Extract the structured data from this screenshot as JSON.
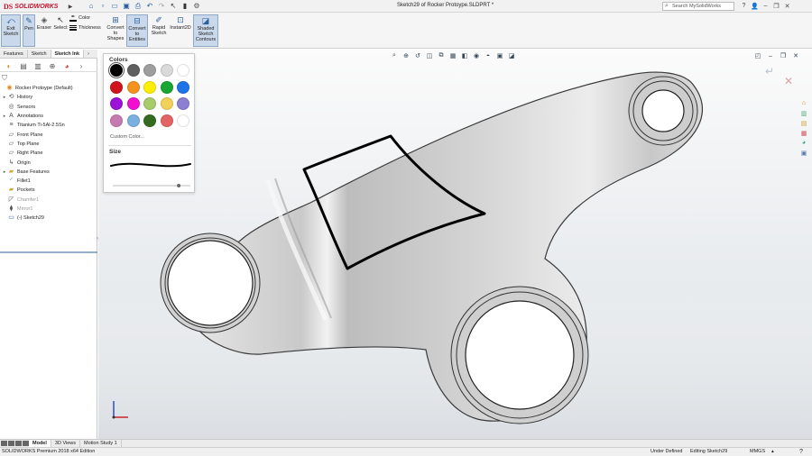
{
  "app": {
    "logo_ds": "DS",
    "logo_text": "SOLIDWORKS",
    "title": "Sketch29 of Rocker Protoype.SLDPRT *",
    "search_placeholder": "Search MySolidWorks",
    "window_controls": [
      "minimize-icon",
      "restore-icon",
      "close-icon"
    ]
  },
  "quick_access": [
    "home-icon",
    "new-icon",
    "open-icon",
    "save-icon",
    "print-icon",
    "undo-icon",
    "redo-icon",
    "select-icon",
    "rebuild-icon",
    "options-icon"
  ],
  "ribbon": {
    "exit_sketch": "Exit Sketch",
    "pen": "Pen",
    "eraser": "Eraser",
    "select": "Select",
    "color": "Color",
    "thickness": "Thickness",
    "convert_shapes": "Convert to Shapes",
    "convert_entities": "Convert to Entities",
    "rapid_sketch": "Rapid Sketch",
    "instant2d": "Instant2D",
    "shaded_contours": "Shaded Sketch Contours"
  },
  "left_panel": {
    "tabs": [
      "Features",
      "Sketch",
      "Sketch Ink"
    ],
    "active_tab": 2,
    "tree": [
      {
        "label": "Rocker Protoype  (Default)",
        "icon": "part-icon",
        "expand": "",
        "indent": 0,
        "faded": false
      },
      {
        "label": "History",
        "icon": "history-icon",
        "expand": "▸",
        "indent": 1,
        "faded": false
      },
      {
        "label": "Sensors",
        "icon": "sensor-icon",
        "expand": "",
        "indent": 1,
        "faded": false
      },
      {
        "label": "Annotations",
        "icon": "annotation-icon",
        "expand": "▸",
        "indent": 1,
        "faded": false
      },
      {
        "label": "Titanium Ti-5Al-2.5Sn",
        "icon": "material-icon",
        "expand": "",
        "indent": 1,
        "faded": false
      },
      {
        "label": "Front Plane",
        "icon": "plane-icon",
        "expand": "",
        "indent": 1,
        "faded": false
      },
      {
        "label": "Top Plane",
        "icon": "plane-icon",
        "expand": "",
        "indent": 1,
        "faded": false
      },
      {
        "label": "Right Plane",
        "icon": "plane-icon",
        "expand": "",
        "indent": 1,
        "faded": false
      },
      {
        "label": "Origin",
        "icon": "origin-icon",
        "expand": "",
        "indent": 1,
        "faded": false
      },
      {
        "label": "Base Features",
        "icon": "folder-icon",
        "expand": "▸",
        "indent": 1,
        "faded": false
      },
      {
        "label": "Fillet1",
        "icon": "fillet-icon",
        "expand": "",
        "indent": 1,
        "faded": false
      },
      {
        "label": "Pockets",
        "icon": "folder-icon",
        "expand": "",
        "indent": 1,
        "faded": false
      },
      {
        "label": "Chamfer1",
        "icon": "chamfer-icon",
        "expand": "",
        "indent": 1,
        "faded": true
      },
      {
        "label": "Mirror1",
        "icon": "mirror-icon",
        "expand": "",
        "indent": 1,
        "faded": true
      },
      {
        "label": "(-) Sketch29",
        "icon": "sketch-icon",
        "expand": "",
        "indent": 1,
        "faded": false
      }
    ]
  },
  "popup": {
    "colors_title": "Colors",
    "swatches": [
      "#000000",
      "#5f5f5f",
      "#9e9e9e",
      "#dadada",
      "#ffffff",
      "#d0141c",
      "#f5921e",
      "#ffee00",
      "#19a532",
      "#1e73e8",
      "#9b11d8",
      "#f20fd0",
      "#a7cc6a",
      "#f2d15a",
      "#8c7fd2",
      "#c57bb0",
      "#7ab0e0",
      "#356b1e",
      "#e46363",
      "#ffffff"
    ],
    "selected_index": 0,
    "custom_color": "Custom Color...",
    "size_title": "Size",
    "size_value": 0.85
  },
  "bottom_tabs": [
    "Model",
    "3D Views",
    "Motion Study 1"
  ],
  "active_bottom_tab": 0,
  "status": {
    "product": "SOLIDWORKS Premium 2018 x64 Edition",
    "definition": "Under Defined",
    "editing": "Editing Sketch29",
    "units": "MMGS"
  },
  "colors": {
    "accent": "#2a5f9e",
    "logo": "#c8102e",
    "ink": "#000000"
  }
}
